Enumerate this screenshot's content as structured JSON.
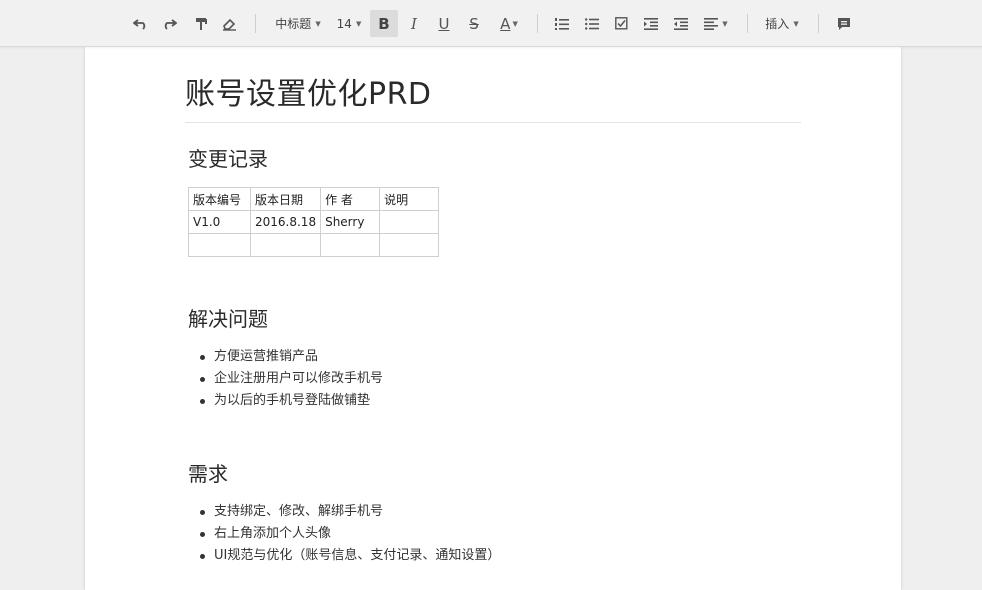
{
  "toolbar": {
    "undo_icon": "undo-icon",
    "redo_icon": "redo-icon",
    "format_painter_icon": "paint-format-icon",
    "clear_format_icon": "eraser-icon",
    "heading_select": "中标题",
    "font_size_select": "14",
    "bold": "B",
    "italic": "I",
    "underline": "U",
    "strikethrough": "S",
    "text_color": "A",
    "insert_menu": "插入",
    "accent_color": "#dcdcdc"
  },
  "document": {
    "title": "账号设置优化PRD",
    "sections": {
      "changelog": {
        "heading": "变更记录",
        "table": {
          "headers": [
            "版本编号",
            "版本日期",
            "作 者",
            "说明"
          ],
          "rows": [
            [
              "V1.0",
              "2016.8.18",
              "Sherry",
              ""
            ],
            [
              "",
              "",
              "",
              ""
            ]
          ]
        }
      },
      "problems": {
        "heading": "解决问题",
        "items": [
          "方便运营推销产品",
          "企业注册用户可以修改手机号",
          "为以后的手机号登陆做铺垫"
        ]
      },
      "requirements": {
        "heading": "需求",
        "items": [
          "支持绑定、修改、解绑手机号",
          "右上角添加个人头像",
          "UI规范与优化（账号信息、支付记录、通知设置）"
        ]
      }
    }
  }
}
